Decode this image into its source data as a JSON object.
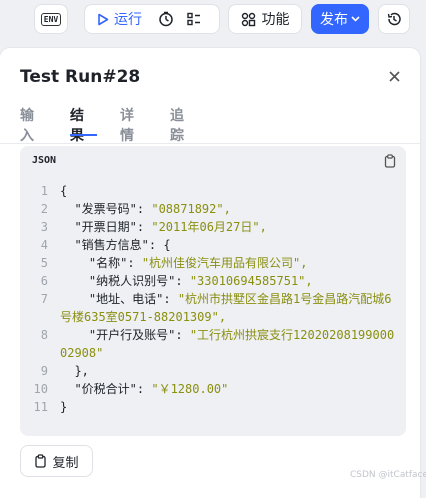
{
  "toolbar": {
    "env_label": "ENV",
    "run_label": "运行",
    "func_label": "功能",
    "publish_label": "发布"
  },
  "panel": {
    "title": "Test Run#28",
    "tabs": [
      {
        "label": "输入",
        "active": false
      },
      {
        "label": "结果",
        "active": true
      },
      {
        "label": "详情",
        "active": false
      },
      {
        "label": "追踪",
        "active": false
      }
    ]
  },
  "code": {
    "language": "JSON",
    "lines": [
      {
        "n": "1",
        "key": "{",
        "value": ""
      },
      {
        "n": "2",
        "key": "  \"发票号码\": ",
        "value": "\"08871892\","
      },
      {
        "n": "3",
        "key": "  \"开票日期\": ",
        "value": "\"2011年06月27日\","
      },
      {
        "n": "4",
        "key": "  \"销售方信息\": {",
        "value": ""
      },
      {
        "n": "5",
        "key": "    \"名称\": ",
        "value": "\"杭州佳俊汽车用品有限公司\","
      },
      {
        "n": "6",
        "key": "    \"纳税人识别号\": ",
        "value": "\"33010694585751\","
      },
      {
        "n": "7",
        "key": "    \"地址、电话\": ",
        "value": "\"杭州市拱墅区金昌路1号金昌路汽配城6号楼635室0571-88201309\","
      },
      {
        "n": "8",
        "key": "    \"开户行及账号\": ",
        "value": "\"工行杭州拱宸支行1202020819900002908\""
      },
      {
        "n": "9",
        "key": "  },",
        "value": ""
      },
      {
        "n": "10",
        "key": "  \"价税合计\": ",
        "value": "\"￥1280.00\""
      },
      {
        "n": "11",
        "key": "}",
        "value": ""
      }
    ]
  },
  "copy_label": "复制",
  "watermark": "CSDN @itCatface",
  "colors": {
    "accent": "#3366ff",
    "string": "#8a8f10"
  }
}
